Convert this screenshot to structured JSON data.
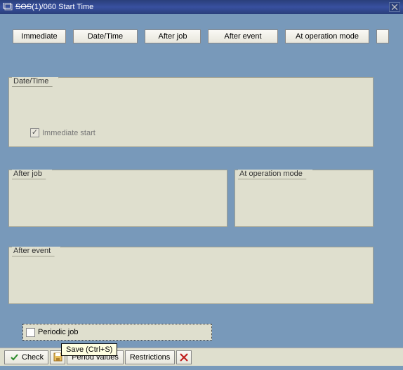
{
  "window": {
    "title": "(1)/060 Start Time"
  },
  "buttons": {
    "immediate": "Immediate",
    "datetime": "Date/Time",
    "afterjob": "After job",
    "afterevent": "After event",
    "opmode": "At operation mode"
  },
  "groups": {
    "datetime_label": "Date/Time",
    "afterjob_label": "After job",
    "opmode_label": "At operation mode",
    "afterevent_label": "After event"
  },
  "checkboxes": {
    "immediate_start": "Immediate start",
    "periodic_job": "Periodic job"
  },
  "toolbar": {
    "check": "Check",
    "period_values": "Period values",
    "restrictions": "Restrictions"
  },
  "tooltip": "Save   (Ctrl+S)"
}
